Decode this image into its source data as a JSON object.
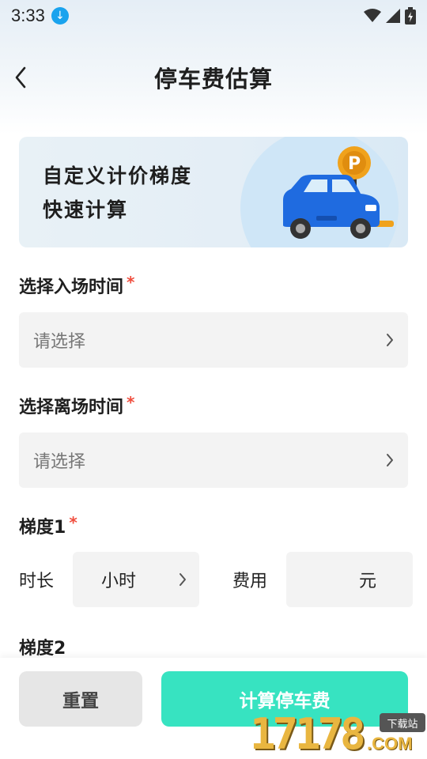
{
  "status_bar": {
    "time": "3:33"
  },
  "header": {
    "title": "停车费估算"
  },
  "banner": {
    "line1": "自定义计价梯度",
    "line2": "快速计算",
    "parking_sign": "P"
  },
  "entry_time": {
    "label": "选择入场时间",
    "required_mark": "*",
    "placeholder": "请选择"
  },
  "exit_time": {
    "label": "选择离场时间",
    "required_mark": "*",
    "placeholder": "请选择"
  },
  "tier1": {
    "label": "梯度1",
    "required_mark": "*",
    "duration_label": "时长",
    "duration_unit": "小时",
    "fee_label": "费用",
    "fee_unit": "元"
  },
  "tier2": {
    "label": "梯度2"
  },
  "actions": {
    "reset": "重置",
    "calculate": "计算停车费"
  },
  "watermark": {
    "number": "17178",
    "domain": ".COM",
    "tag": "下载站"
  },
  "colors": {
    "accent": "#37e3c1",
    "required": "#f04e3e",
    "download_badge": "#1aa3ee",
    "car_body": "#1f6be0",
    "parking_sign": "#f0a21c"
  }
}
